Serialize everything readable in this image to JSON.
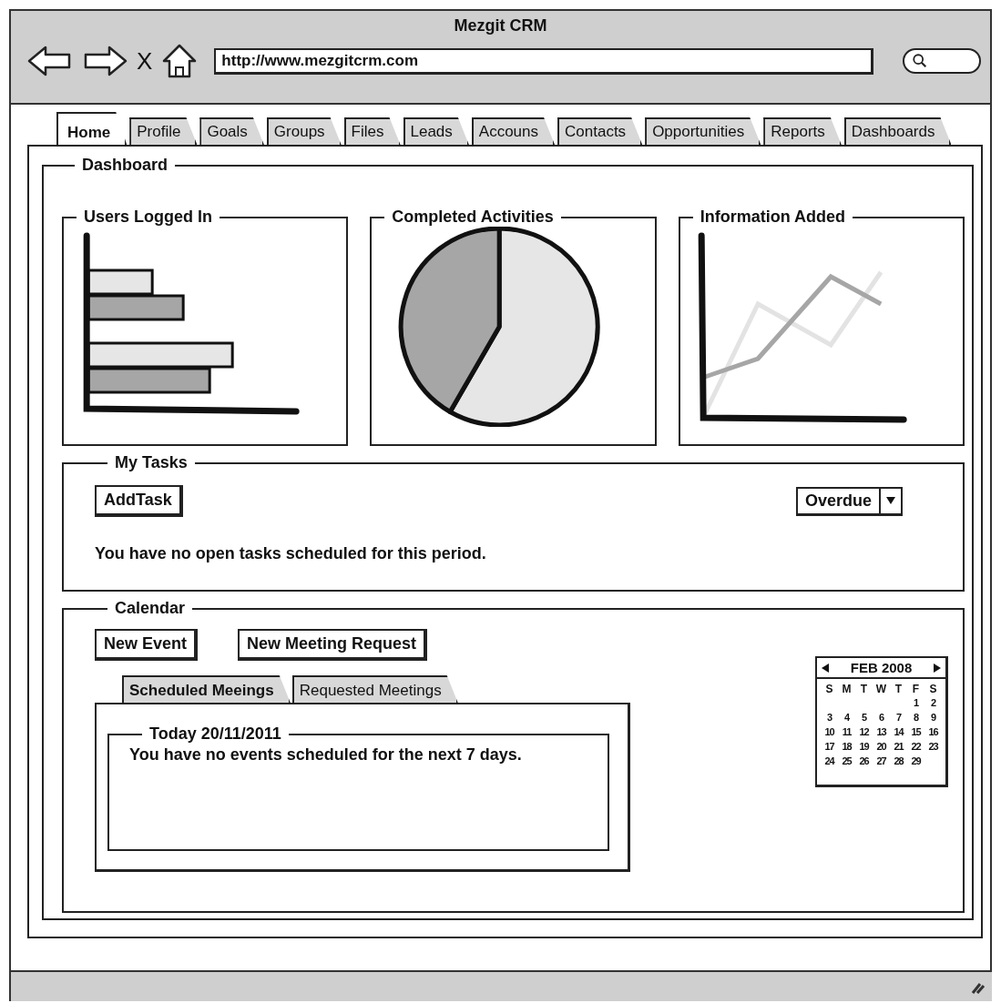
{
  "window": {
    "title": "Mezgit CRM"
  },
  "toolbar": {
    "stop": "X",
    "url": "http://www.mezgitcrm.com"
  },
  "tabs": [
    {
      "label": "Home",
      "selected": true
    },
    {
      "label": "Profile",
      "selected": false
    },
    {
      "label": "Goals",
      "selected": false
    },
    {
      "label": "Groups",
      "selected": false
    },
    {
      "label": "Files",
      "selected": false
    },
    {
      "label": "Leads",
      "selected": false
    },
    {
      "label": "Accouns",
      "selected": false
    },
    {
      "label": "Contacts",
      "selected": false
    },
    {
      "label": "Opportunities",
      "selected": false
    },
    {
      "label": "Reports",
      "selected": false
    },
    {
      "label": "Dashboards",
      "selected": false
    }
  ],
  "dashboard": {
    "title": "Dashboard",
    "charts": [
      {
        "title": "Users Logged In",
        "kind": "bar"
      },
      {
        "title": "Completed Activities",
        "kind": "pie"
      },
      {
        "title": "Information Added",
        "kind": "line"
      }
    ]
  },
  "tasks": {
    "title": "My Tasks",
    "add_button": "AddTask",
    "filter": "Overdue",
    "message": "You have no open tasks scheduled for this period."
  },
  "calendar": {
    "title": "Calendar",
    "buttons": [
      "New Event",
      "New Meeting Request"
    ],
    "tabs": [
      {
        "label": "Scheduled Meeings",
        "selected": true
      },
      {
        "label": "Requested Meetings",
        "selected": false
      }
    ],
    "day_panel": {
      "title": "Today 20/11/2011",
      "message": "You have no events scheduled for the next 7 days."
    },
    "mini_calendar": {
      "month": "FEB 2008",
      "weekdays": [
        "S",
        "M",
        "T",
        "W",
        "T",
        "F",
        "S"
      ],
      "weeks": [
        [
          "1",
          "2"
        ],
        [
          "3",
          "4",
          "5",
          "6",
          "7",
          "8",
          "9"
        ],
        [
          "10",
          "11",
          "12",
          "13",
          "14",
          "15",
          "16"
        ],
        [
          "17",
          "18",
          "19",
          "20",
          "21",
          "22",
          "23"
        ],
        [
          "24",
          "25",
          "26",
          "27",
          "28",
          "29"
        ]
      ]
    }
  }
}
